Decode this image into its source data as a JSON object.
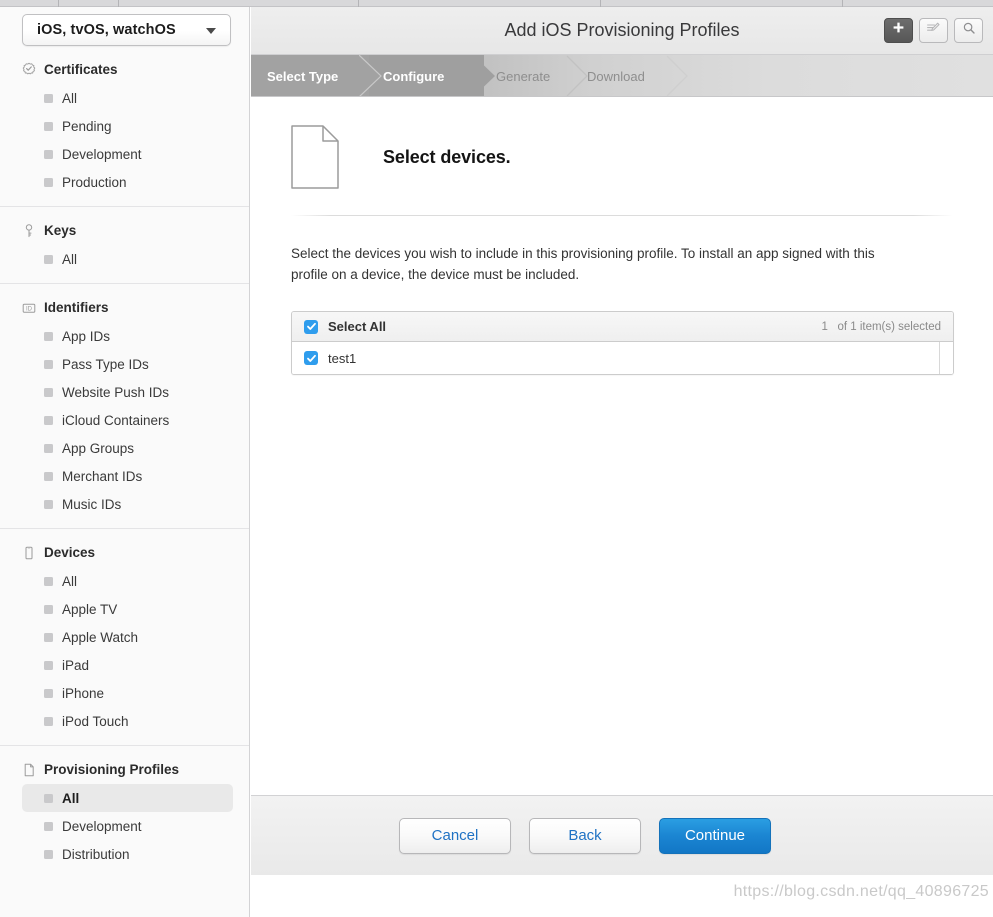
{
  "os_select": {
    "value": "iOS, tvOS, watchOS",
    "caret_icon": "chevron-down-icon"
  },
  "sidebar": {
    "sections": [
      {
        "title": "Certificates",
        "icon": "certificate-seal-icon",
        "items": [
          {
            "label": "All",
            "selected": false
          },
          {
            "label": "Pending",
            "selected": false
          },
          {
            "label": "Development",
            "selected": false
          },
          {
            "label": "Production",
            "selected": false
          }
        ]
      },
      {
        "title": "Keys",
        "icon": "key-icon",
        "items": [
          {
            "label": "All",
            "selected": false
          }
        ]
      },
      {
        "title": "Identifiers",
        "icon": "id-badge-icon",
        "items": [
          {
            "label": "App IDs",
            "selected": false
          },
          {
            "label": "Pass Type IDs",
            "selected": false
          },
          {
            "label": "Website Push IDs",
            "selected": false
          },
          {
            "label": "iCloud Containers",
            "selected": false
          },
          {
            "label": "App Groups",
            "selected": false
          },
          {
            "label": "Merchant IDs",
            "selected": false
          },
          {
            "label": "Music IDs",
            "selected": false
          }
        ]
      },
      {
        "title": "Devices",
        "icon": "device-phone-icon",
        "items": [
          {
            "label": "All",
            "selected": false
          },
          {
            "label": "Apple TV",
            "selected": false
          },
          {
            "label": "Apple Watch",
            "selected": false
          },
          {
            "label": "iPad",
            "selected": false
          },
          {
            "label": "iPhone",
            "selected": false
          },
          {
            "label": "iPod Touch",
            "selected": false
          }
        ]
      },
      {
        "title": "Provisioning Profiles",
        "icon": "document-icon",
        "items": [
          {
            "label": "All",
            "selected": true
          },
          {
            "label": "Development",
            "selected": false
          },
          {
            "label": "Distribution",
            "selected": false
          }
        ]
      }
    ]
  },
  "header": {
    "title": "Add iOS Provisioning Profiles",
    "buttons": [
      {
        "name": "add-button",
        "icon": "plus-icon",
        "active": true
      },
      {
        "name": "edit-button",
        "icon": "edit-pencil-icon",
        "active": false
      },
      {
        "name": "search-button",
        "icon": "search-icon",
        "active": false
      }
    ]
  },
  "steps": [
    {
      "label": "Select Type",
      "state": "complete"
    },
    {
      "label": "Configure",
      "state": "current"
    },
    {
      "label": "Generate",
      "state": "upcoming"
    },
    {
      "label": "Download",
      "state": "upcoming"
    }
  ],
  "main": {
    "icon": "document-icon",
    "heading": "Select devices.",
    "description": "Select the devices you wish to include in this provisioning profile. To install an app signed with this profile on a device, the device must be included."
  },
  "device_table": {
    "select_all_label": "Select All",
    "select_all_checked": true,
    "selected_count_text": "1   of 1 item(s) selected",
    "rows": [
      {
        "label": "test1",
        "checked": true
      }
    ]
  },
  "footer": {
    "cancel_label": "Cancel",
    "back_label": "Back",
    "continue_label": "Continue"
  },
  "watermark": "https://blog.csdn.net/qq_40896725",
  "colors": {
    "accent_blue": "#2f9ded",
    "primary_button_blue": "#1b85d2",
    "link_blue": "#1f72c4",
    "sidebar_bg": "#fafafa",
    "step_active_gray": "#a2a2a2"
  }
}
